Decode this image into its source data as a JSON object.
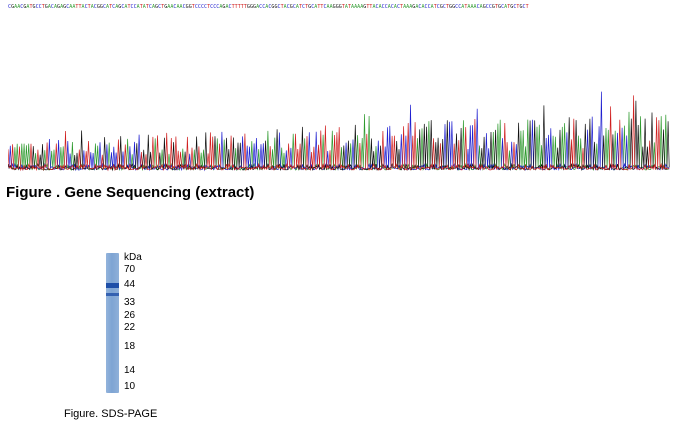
{
  "sequencing_figure": {
    "caption": "Figure . Gene Sequencing (extract)",
    "base_colors": {
      "A": "#2e9a2e",
      "C": "#1f1fd0",
      "G": "#111111",
      "T": "#d01f1f"
    }
  },
  "sds_page_figure": {
    "caption": "Figure. SDS-PAGE",
    "unit": "kDa",
    "marker_labels": [
      "70",
      "44",
      "33",
      "26",
      "22",
      "18",
      "14",
      "10"
    ],
    "lane_color": "#8aadd8",
    "band_color": "#1f4fa8"
  }
}
